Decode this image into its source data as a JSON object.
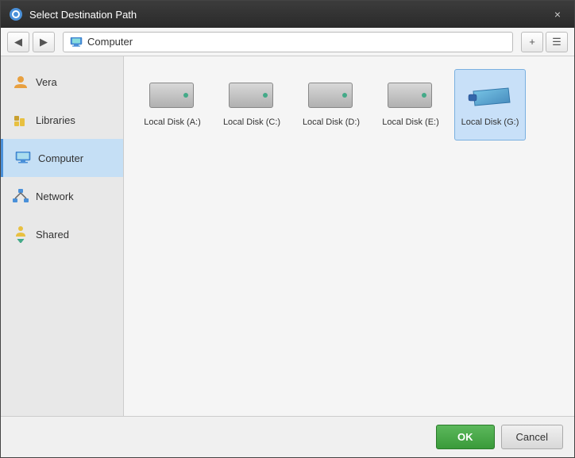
{
  "dialog": {
    "title": "Select Destination Path",
    "close_label": "×"
  },
  "toolbar": {
    "back_label": "◀",
    "forward_label": "▶",
    "breadcrumb": "Computer",
    "new_folder_label": "+",
    "view_label": "☰"
  },
  "sidebar": {
    "items": [
      {
        "id": "vera",
        "label": "Vera",
        "icon": "user-icon"
      },
      {
        "id": "libraries",
        "label": "Libraries",
        "icon": "library-icon"
      },
      {
        "id": "computer",
        "label": "Computer",
        "icon": "computer-icon",
        "active": true
      },
      {
        "id": "network",
        "label": "Network",
        "icon": "network-icon"
      },
      {
        "id": "shared",
        "label": "Shared",
        "icon": "shared-icon"
      }
    ]
  },
  "disks": [
    {
      "id": "a",
      "label": "Local Disk (A:)",
      "type": "hdd",
      "selected": false
    },
    {
      "id": "c",
      "label": "Local Disk (C:)",
      "type": "hdd",
      "selected": false
    },
    {
      "id": "d",
      "label": "Local Disk (D:)",
      "type": "hdd",
      "selected": false
    },
    {
      "id": "e",
      "label": "Local Disk (E:)",
      "type": "hdd",
      "selected": false
    },
    {
      "id": "g",
      "label": "Local Disk (G:)",
      "type": "usb",
      "selected": true
    }
  ],
  "footer": {
    "ok_label": "OK",
    "cancel_label": "Cancel"
  }
}
